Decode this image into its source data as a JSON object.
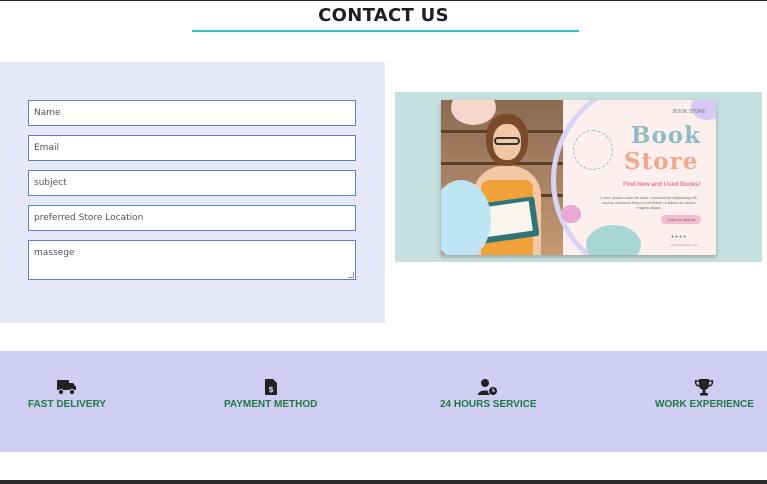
{
  "header": {
    "title": "CONTACT US"
  },
  "form": {
    "fields": [
      {
        "placeholder": "Name"
      },
      {
        "placeholder": "Email"
      },
      {
        "placeholder": "subject"
      },
      {
        "placeholder": "preferred Store Location"
      },
      {
        "placeholder": "massege"
      }
    ]
  },
  "ad": {
    "logo_text": "BOOK STORE",
    "word1": "Book",
    "word2": "Store",
    "tagline": "Find New and Used Books!",
    "body": "Lorem ipsum dolor sit amet, consectetur adipiscing elit, sed do eiusmod tempor incididunt ut labore et dolore magna aliqua.",
    "button": "Come to visit us",
    "website": "www.bookstore.com"
  },
  "features": [
    {
      "label": "FAST DELIVERY",
      "icon": "truck-icon"
    },
    {
      "label": "PAYMENT METHOD",
      "icon": "invoice-dollar-icon"
    },
    {
      "label": "24 HOURS SERVICE",
      "icon": "user-clock-icon"
    },
    {
      "label": "WORK EXPERIENCE",
      "icon": "trophy-icon"
    }
  ],
  "colors": {
    "accent": "#2ec4c4",
    "form_bg": "#e8e8fb",
    "features_bg": "#cfcdf1",
    "feature_text": "#1f7a44"
  }
}
